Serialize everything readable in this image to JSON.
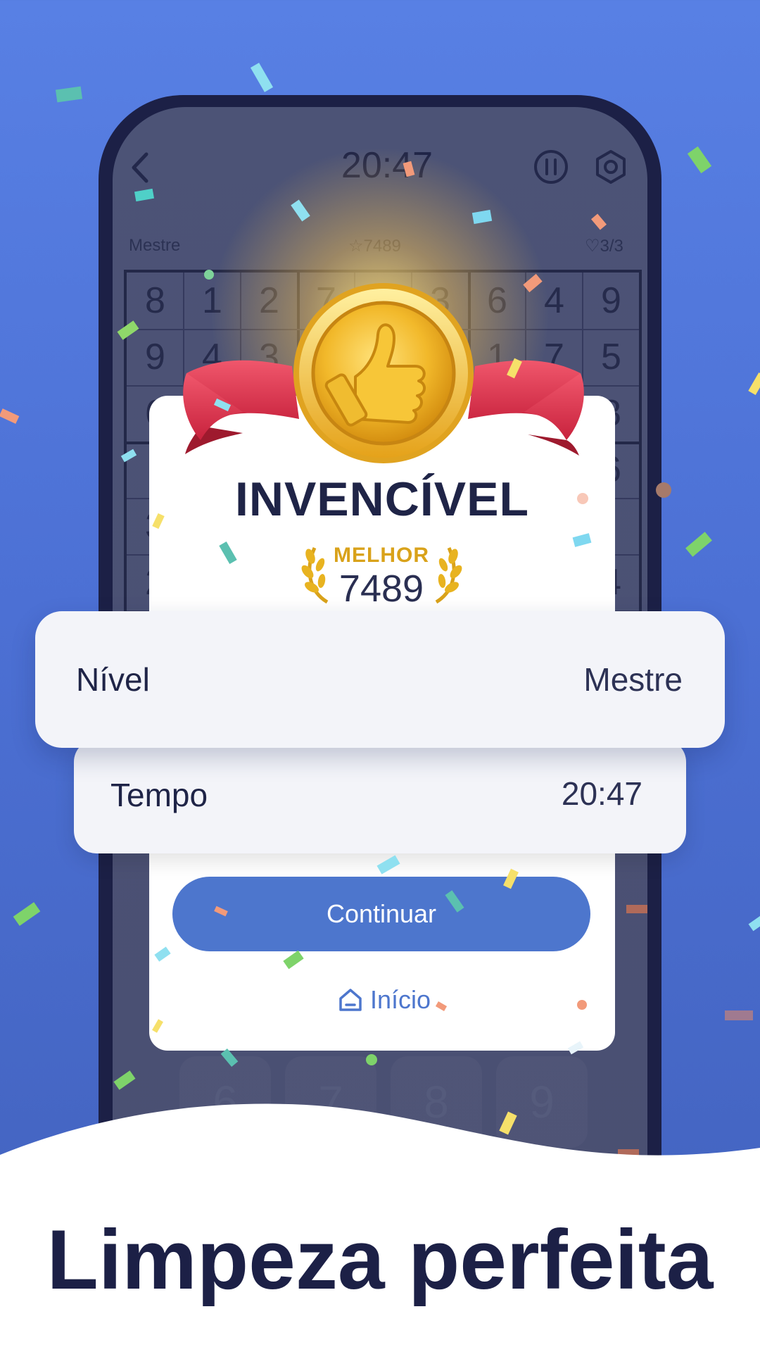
{
  "game_header": {
    "timer": "20:47",
    "difficulty": "Mestre",
    "score": "7489",
    "lives": "3/3"
  },
  "board_rows": [
    [
      "8",
      "1",
      "2",
      "7",
      "",
      "3",
      "6",
      "4",
      "9"
    ],
    [
      "9",
      "4",
      "3",
      "",
      "",
      "",
      "1",
      "7",
      "5"
    ],
    [
      "6",
      "",
      "",
      "",
      "",
      "",
      "",
      "",
      "8"
    ],
    [
      "",
      "",
      "",
      "",
      "",
      "",
      "",
      "",
      "6"
    ],
    [
      "3",
      "",
      "",
      "",
      "",
      "",
      "",
      "",
      "",
      ""
    ],
    [
      "2",
      "",
      "",
      "",
      "",
      "",
      "",
      "",
      "4"
    ]
  ],
  "keypad": [
    "6",
    "7",
    "8",
    "9"
  ],
  "dialog": {
    "title": "INVENCÍVEL",
    "best_label": "MELHOR",
    "best_value": "7489",
    "level_label": "Nível",
    "level_value": "Mestre",
    "time_label": "Tempo",
    "time_value": "20:47",
    "continue_label": "Continuar",
    "home_label": "Início"
  },
  "headline": "Limpeza perfeita",
  "colors": {
    "background_top": "#5880e4",
    "background_bottom": "#4262bd",
    "primary_button": "#4d76cd",
    "medal_gold": "#f2c12e",
    "ribbon_red": "#e23a54",
    "text_dark": "#1f2447",
    "best_gold": "#d9a21a"
  },
  "icons": [
    "back-chevron-icon",
    "pause-icon",
    "settings-gear-icon",
    "star-icon",
    "heart-icon",
    "thumbs-up-medal-icon",
    "laurel-wreath-icon",
    "home-icon"
  ]
}
